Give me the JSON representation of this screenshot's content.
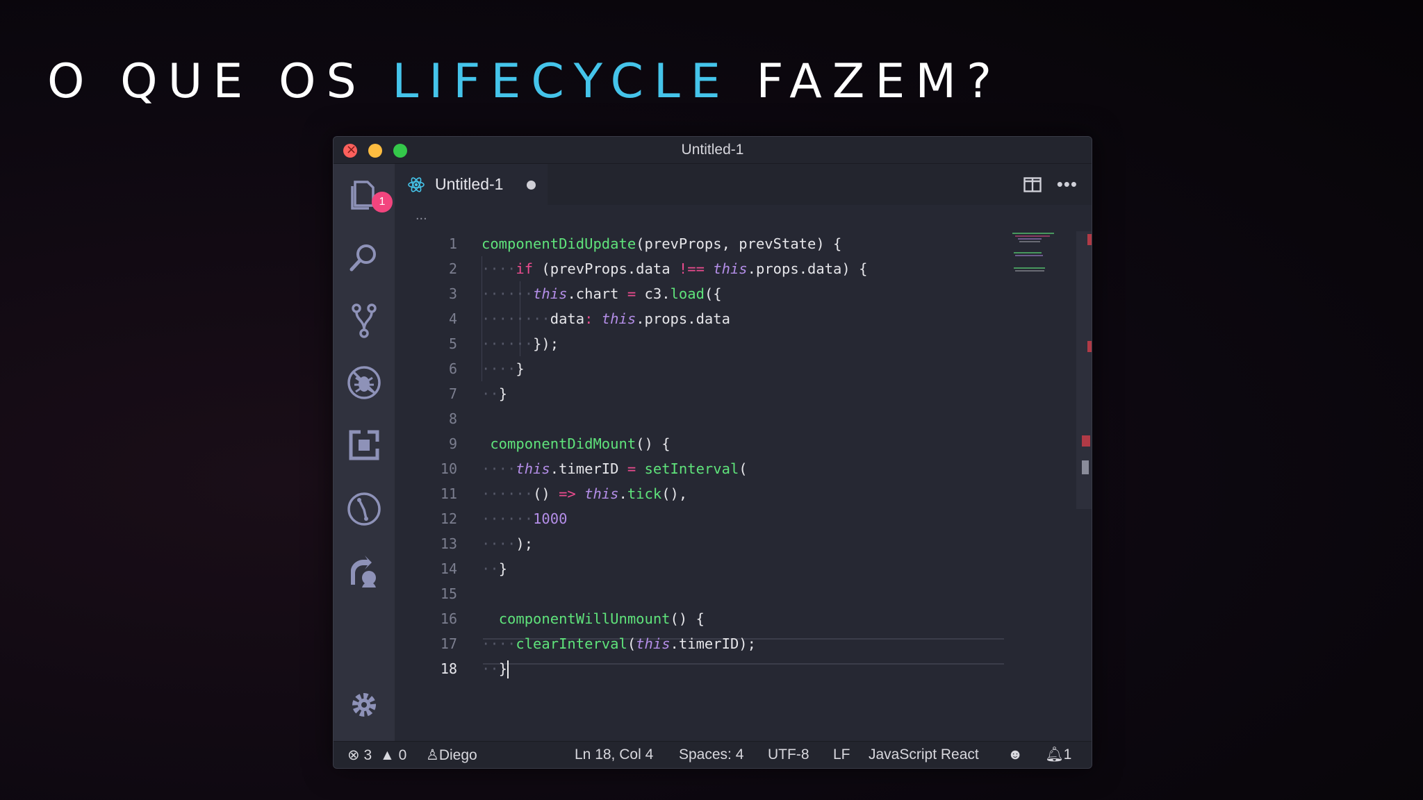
{
  "slide": {
    "title_pre": "O QUE OS ",
    "title_accent": "LIFECYCLE",
    "title_post": " FAZEM?"
  },
  "window": {
    "title": "Untitled-1"
  },
  "activity_bar": {
    "explorer_badge": "1",
    "icons": [
      "files-icon",
      "search-icon",
      "source-control-icon",
      "debug-icon",
      "extensions-icon",
      "git-icon",
      "live-share-icon",
      "gear-icon"
    ]
  },
  "tab": {
    "label": "Untitled-1",
    "modified": true
  },
  "breadcrumb": "...",
  "editor": {
    "line_numbers": [
      "1",
      "2",
      "3",
      "4",
      "5",
      "6",
      "7",
      "8",
      "9",
      "10",
      "11",
      "12",
      "13",
      "14",
      "15",
      "16",
      "17",
      "18"
    ],
    "current_line": "18"
  },
  "status": {
    "errors": "3",
    "warnings": "0",
    "user": "Diego",
    "position": "Ln 18, Col 4",
    "spaces": "Spaces: 4",
    "encoding": "UTF-8",
    "eol": "LF",
    "language": "JavaScript React",
    "notifications": "1"
  },
  "colors": {
    "accent": "#45c4ea",
    "keyword": "#ec4c8f",
    "function": "#5fe37b",
    "this": "#b48ee8",
    "badge": "#f2457e"
  }
}
